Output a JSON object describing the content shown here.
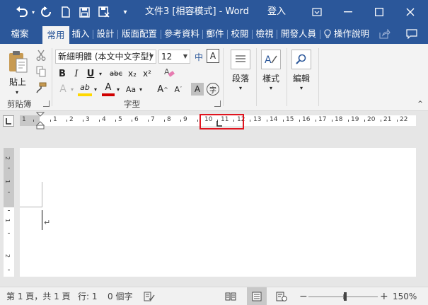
{
  "window": {
    "title": "文件3 [相容模式]  -  Word",
    "sign_in": "登入"
  },
  "tabs": [
    {
      "label": "檔案"
    },
    {
      "label": "常用"
    },
    {
      "label": "插入"
    },
    {
      "label": "設計"
    },
    {
      "label": "版面配置"
    },
    {
      "label": "參考資料"
    },
    {
      "label": "郵件"
    },
    {
      "label": "校閱"
    },
    {
      "label": "檢視"
    },
    {
      "label": "開發人員"
    },
    {
      "label": "操作說明"
    }
  ],
  "ribbon": {
    "clipboard": {
      "paste_label": "貼上",
      "group_label": "剪貼簿"
    },
    "font": {
      "font_name": "新細明體 (本文中文字型)",
      "font_size": "12",
      "group_label": "字型",
      "bold": "B",
      "italic": "I",
      "underline": "U",
      "strike": "abc",
      "subscript": "x₂",
      "superscript": "x²",
      "effects": "A",
      "highlight": "ab",
      "font_color": "A",
      "change_case": "Aa",
      "grow": "A",
      "shrink": "A",
      "shading": "A",
      "enclose": "字",
      "phonetic": "中",
      "border": "A"
    },
    "paragraph": {
      "label": "段落"
    },
    "styles": {
      "label": "樣式"
    },
    "editing": {
      "label": "編輯"
    }
  },
  "ruler": {
    "numbers": [
      "1",
      "1",
      "2",
      "3",
      "4",
      "5",
      "6",
      "7",
      "8",
      "9",
      "10",
      "11",
      "12",
      "13",
      "14",
      "15",
      "16",
      "17",
      "18",
      "19",
      "20",
      "21",
      "22"
    ],
    "vertical_numbers": [
      "2",
      "1",
      "1",
      "2"
    ]
  },
  "document": {
    "paragraph_mark": "↵"
  },
  "status": {
    "page": "第 1 頁，共 1 頁",
    "line": "行: 1",
    "words": "0 個字",
    "zoom": "150%"
  },
  "colors": {
    "brand": "#2b579a",
    "highlight_box": "#e0141e"
  }
}
